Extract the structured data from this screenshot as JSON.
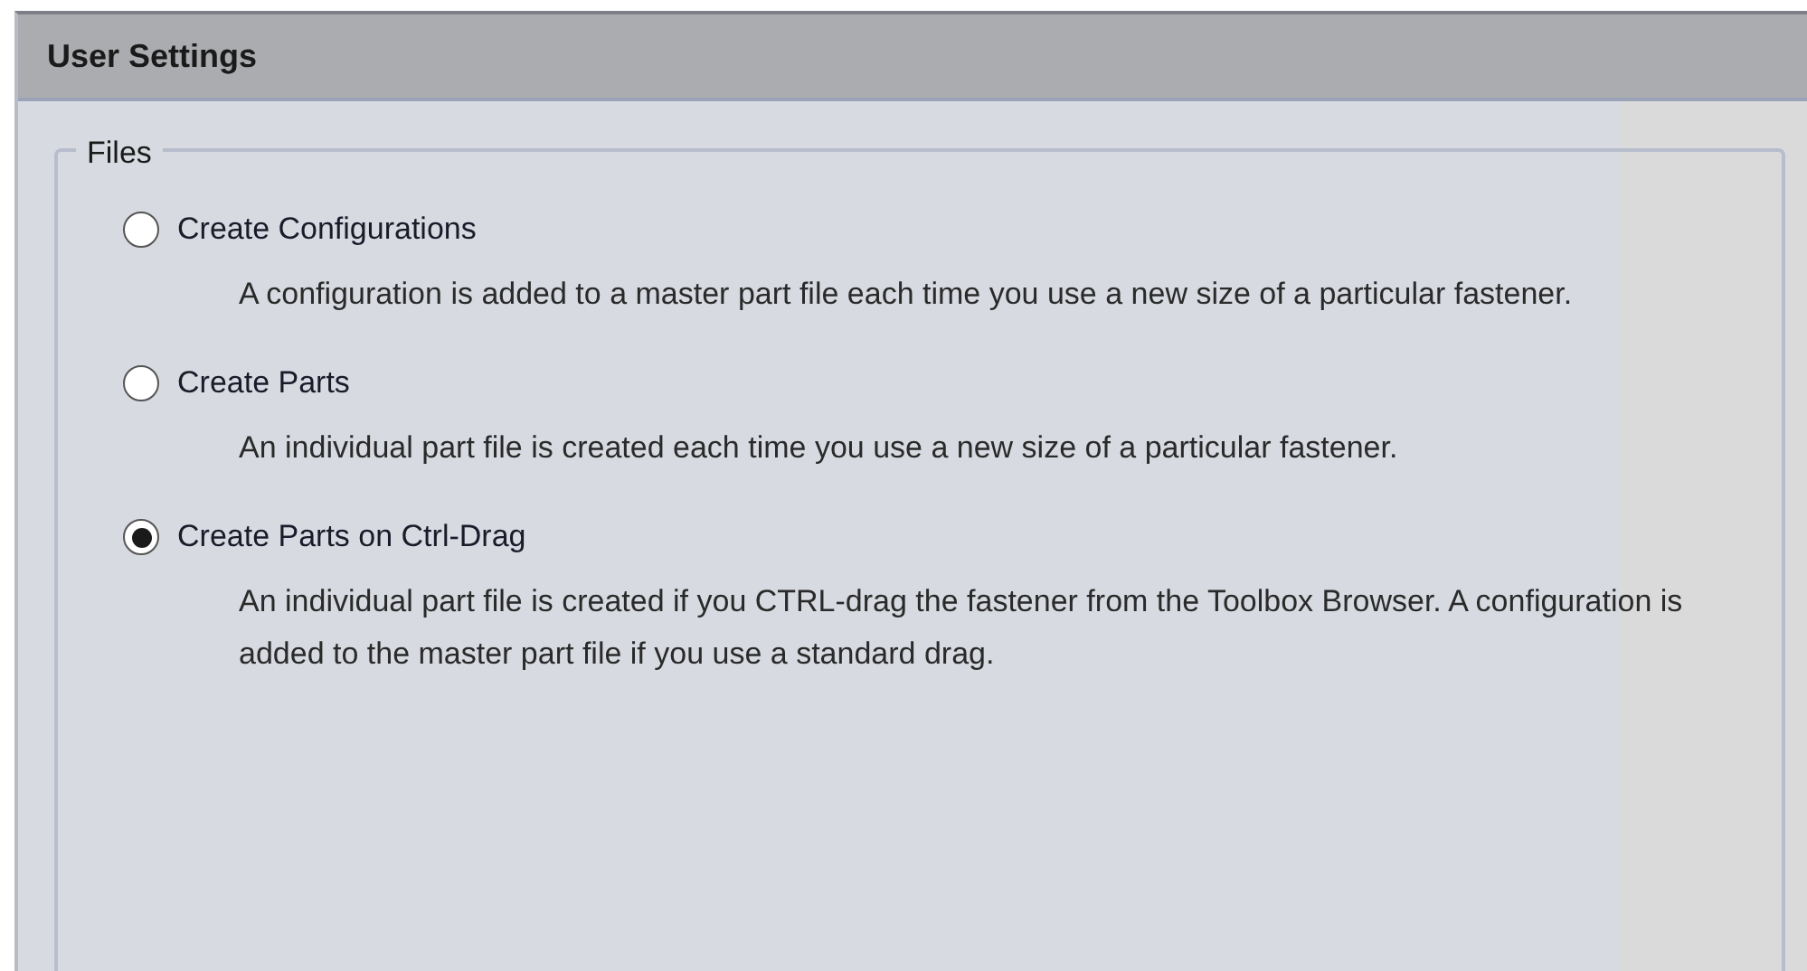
{
  "panel": {
    "title": "User Settings"
  },
  "group": {
    "label": "Files",
    "options": [
      {
        "label": "Create Configurations",
        "selected": false,
        "description": "A configuration is added to a master part file each time you use a new size of a particular fastener."
      },
      {
        "label": "Create Parts",
        "selected": false,
        "description": "An individual part file is created each time you use a new size of a particular fastener."
      },
      {
        "label": "Create Parts on Ctrl-Drag",
        "selected": true,
        "description": "An individual part file is created if you CTRL-drag the fastener from the Toolbox Browser. A configuration is added to the master part file if you use a standard drag."
      }
    ]
  }
}
